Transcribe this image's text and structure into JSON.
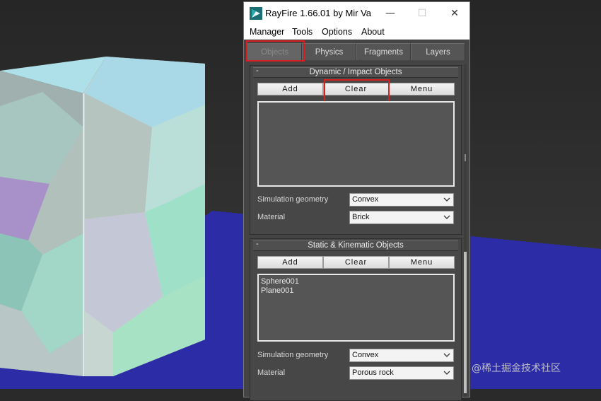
{
  "window": {
    "title": "RayFire 1.66.01  by Mir Va",
    "app_icon": "rayfire-app-icon",
    "controls": {
      "minimize": "—",
      "maximize": "☐",
      "close": "✕"
    }
  },
  "menu": {
    "items": [
      {
        "label": "Manager"
      },
      {
        "label": "Tools"
      },
      {
        "label": "Options"
      },
      {
        "label": "About"
      }
    ]
  },
  "tabs": [
    {
      "label": "Objects",
      "active": true
    },
    {
      "label": "Physics"
    },
    {
      "label": "Fragments"
    },
    {
      "label": "Layers"
    }
  ],
  "dynamic_rollout": {
    "collapse_symbol": "-",
    "title": "Dynamic / Impact Objects",
    "buttons": {
      "add": "Add",
      "clear": "Clear",
      "menu": "Menu"
    },
    "list_items": [],
    "sim_geometry_label": "Simulation geometry",
    "sim_geometry_value": "Convex",
    "material_label": "Material",
    "material_value": "Brick"
  },
  "static_rollout": {
    "collapse_symbol": "-",
    "title": "Static & Kinematic Objects",
    "buttons": {
      "add": "Add",
      "clear": "Clear",
      "menu": "Menu"
    },
    "list_items": [
      "Sphere001",
      "Plane001"
    ],
    "sim_geometry_label": "Simulation geometry",
    "sim_geometry_value": "Convex",
    "material_label": "Material",
    "material_value": "Porous rock"
  },
  "watermark": "@稀土掘金技术社区",
  "colors": {
    "highlight": "#d62020",
    "floor_plane": "#2a2aa8",
    "panel_bg": "#444444"
  }
}
